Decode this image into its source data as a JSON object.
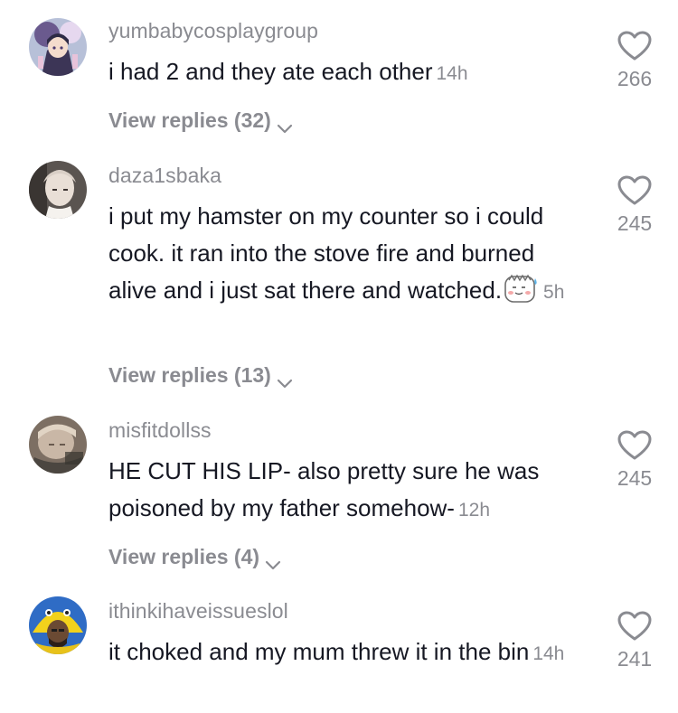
{
  "comments": [
    {
      "username": "yumbabycosplaygroup",
      "text": "i had 2 and they ate each other",
      "time": "14h",
      "replies": "View replies (32)",
      "likes": "266",
      "avatar": "anime-girl-avatar"
    },
    {
      "username": "daza1sbaka",
      "text": "i put my hamster on my counter so i could cook. it ran into the stove fire and burned alive and i just sat there and watched.",
      "time": "5h",
      "emoji": "sweat-smile-emoji",
      "replies": "View replies (13)",
      "likes": "245",
      "avatar": "anime-character-avatar"
    },
    {
      "username": "misfitdollss",
      "text": "HE CUT HIS LIP- also pretty sure he was poisoned by my father somehow-",
      "time": "12h",
      "replies": "View replies (4)",
      "likes": "245",
      "avatar": "baby-photo-avatar"
    },
    {
      "username": "ithinkihaveissueslol",
      "text": "it choked and my mum threw it in the bin",
      "time": "14h",
      "likes": "241",
      "avatar": "person-costume-avatar"
    }
  ],
  "colors": {
    "text": "#161823",
    "secondary": "#8a8b91",
    "background": "#ffffff"
  }
}
